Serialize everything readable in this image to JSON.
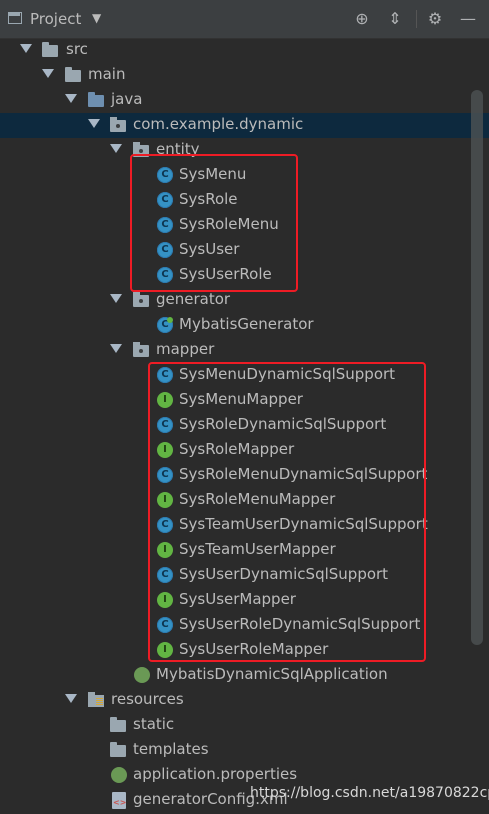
{
  "toolbar": {
    "title": "Project",
    "dropdown_icon": "caret-down-icon",
    "buttons": [
      "locate-icon",
      "collapse-all-icon",
      "gear-icon",
      "minimize-icon"
    ]
  },
  "tree": {
    "src": "src",
    "main": "main",
    "java": "java",
    "package": "com.example.dynamic",
    "entity": {
      "label": "entity",
      "items": [
        "SysMenu",
        "SysRole",
        "SysRoleMenu",
        "SysUser",
        "SysUserRole"
      ]
    },
    "generator": {
      "label": "generator",
      "items": [
        "MybatisGenerator"
      ]
    },
    "mapper": {
      "label": "mapper",
      "items": [
        {
          "name": "SysMenuDynamicSqlSupport",
          "kind": "class"
        },
        {
          "name": "SysMenuMapper",
          "kind": "interface"
        },
        {
          "name": "SysRoleDynamicSqlSupport",
          "kind": "class"
        },
        {
          "name": "SysRoleMapper",
          "kind": "interface"
        },
        {
          "name": "SysRoleMenuDynamicSqlSupport",
          "kind": "class"
        },
        {
          "name": "SysRoleMenuMapper",
          "kind": "interface"
        },
        {
          "name": "SysTeamUserDynamicSqlSupport",
          "kind": "class"
        },
        {
          "name": "SysTeamUserMapper",
          "kind": "interface"
        },
        {
          "name": "SysUserDynamicSqlSupport",
          "kind": "class"
        },
        {
          "name": "SysUserMapper",
          "kind": "interface"
        },
        {
          "name": "SysUserRoleDynamicSqlSupport",
          "kind": "class"
        },
        {
          "name": "SysUserRoleMapper",
          "kind": "interface"
        }
      ]
    },
    "application": "MybatisDynamicSqlApplication",
    "resources": {
      "label": "resources",
      "static": "static",
      "templates": "templates",
      "properties": "application.properties",
      "generator_config": "generatorConfig.xml"
    }
  },
  "watermark": "https://blog.csdn.net/a19870822cp",
  "colors": {
    "background": "#2b2b2b",
    "selected_row": "#0d293e",
    "highlight_box": "#ee1c25",
    "class_icon": "#3592c4",
    "interface_icon": "#62b543"
  }
}
